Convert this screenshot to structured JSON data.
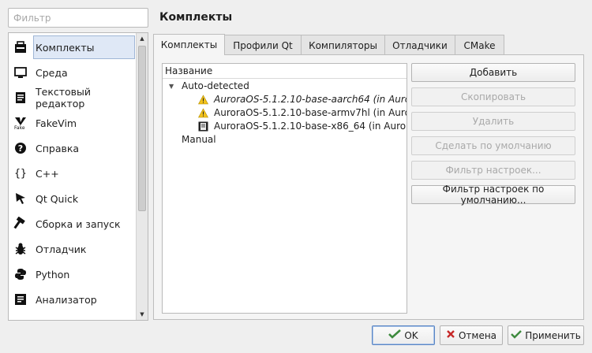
{
  "filter": {
    "placeholder": "Фильтр",
    "value": ""
  },
  "sidebar": {
    "items": [
      {
        "label": "Комплекты",
        "icon": "kits-icon"
      },
      {
        "label": "Среда",
        "icon": "monitor-icon"
      },
      {
        "label": "Текстовый редактор",
        "icon": "text-editor-icon"
      },
      {
        "label": "FakeVim",
        "icon": "fakevim-icon"
      },
      {
        "label": "Справка",
        "icon": "help-icon"
      },
      {
        "label": "C++",
        "icon": "cpp-braces-icon"
      },
      {
        "label": "Qt Quick",
        "icon": "qt-quick-icon"
      },
      {
        "label": "Сборка и запуск",
        "icon": "hammer-icon"
      },
      {
        "label": "Отладчик",
        "icon": "bug-icon"
      },
      {
        "label": "Python",
        "icon": "python-icon"
      },
      {
        "label": "Анализатор",
        "icon": "analyzer-icon"
      }
    ]
  },
  "page": {
    "title": "Комплекты"
  },
  "tabs": [
    {
      "label": "Комплекты"
    },
    {
      "label": "Профили Qt"
    },
    {
      "label": "Компиляторы"
    },
    {
      "label": "Отладчики"
    },
    {
      "label": "CMake"
    }
  ],
  "tree": {
    "header": "Название",
    "groups": [
      {
        "label": "Auto-detected",
        "items": [
          {
            "label": "AuroraOS-5.1.2.10-base-aarch64 (in Aurora",
            "icon": "warning-icon",
            "italic": true
          },
          {
            "label": "AuroraOS-5.1.2.10-base-armv7hl (in Aurora",
            "icon": "warning-icon",
            "italic": false
          },
          {
            "label": "AuroraOS-5.1.2.10-base-x86_64 (in Auror",
            "icon": "device-icon",
            "italic": false
          }
        ]
      },
      {
        "label": "Manual",
        "items": []
      }
    ]
  },
  "buttons": {
    "add": "Добавить",
    "copy": "Скопировать",
    "remove": "Удалить",
    "make_default": "Сделать по умолчанию",
    "settings_filter": "Фильтр настроек...",
    "default_settings_filter": "Фильтр настроек по умолчанию..."
  },
  "footer": {
    "ok": "OK",
    "cancel": "Отмена",
    "apply": "Применить"
  },
  "colors": {
    "warning": "#f2c21b",
    "ok_check": "#3d8a3d",
    "cancel_x": "#c62828",
    "selection": "#dfe8f6"
  }
}
